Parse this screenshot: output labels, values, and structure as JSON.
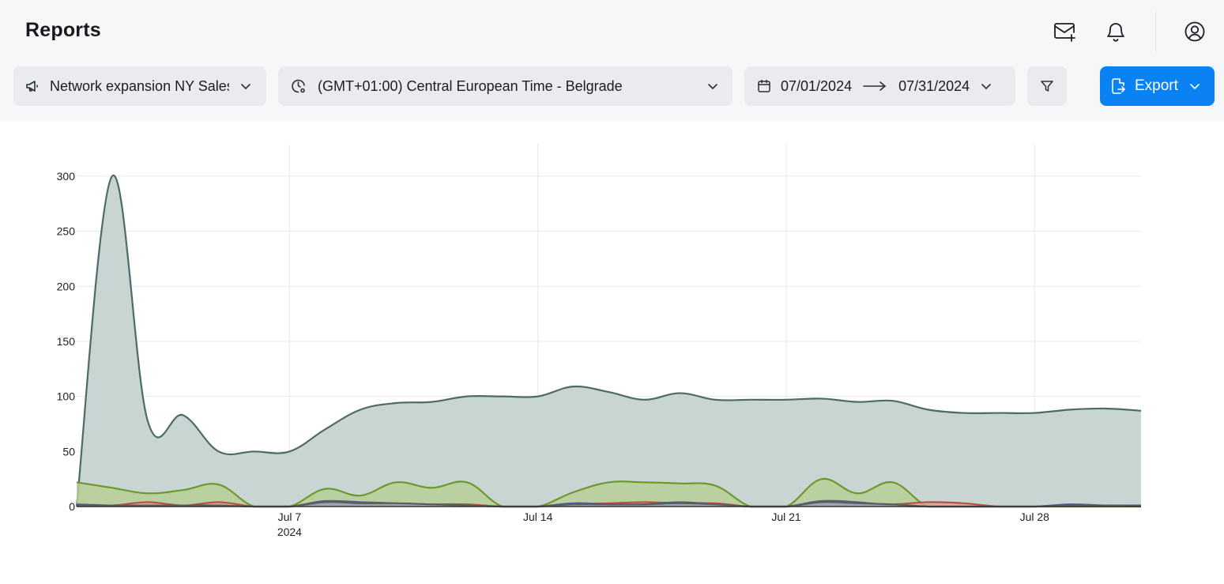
{
  "header": {
    "title": "Reports"
  },
  "icons": {
    "mail": "mail-plus-icon",
    "bell": "bell-icon",
    "user": "user-circle-icon"
  },
  "filters": {
    "campaign": {
      "label": "Network expansion NY Sales",
      "icon": "megaphone-icon"
    },
    "timezone": {
      "label": "(GMT+01:00) Central European Time - Belgrade",
      "icon": "clock-pin-icon"
    },
    "date_start": "07/01/2024",
    "date_end": "07/31/2024",
    "filter_icon": "funnel-icon"
  },
  "export": {
    "label": "Export",
    "color": "#0b82f4"
  },
  "chart_data": {
    "type": "area",
    "x": [
      "2024-07-01",
      "2024-07-02",
      "2024-07-03",
      "2024-07-04",
      "2024-07-05",
      "2024-07-06",
      "2024-07-07",
      "2024-07-08",
      "2024-07-09",
      "2024-07-10",
      "2024-07-11",
      "2024-07-12",
      "2024-07-13",
      "2024-07-14",
      "2024-07-15",
      "2024-07-16",
      "2024-07-17",
      "2024-07-18",
      "2024-07-19",
      "2024-07-20",
      "2024-07-21",
      "2024-07-22",
      "2024-07-23",
      "2024-07-24",
      "2024-07-25",
      "2024-07-26",
      "2024-07-27",
      "2024-07-28",
      "2024-07-29",
      "2024-07-30",
      "2024-07-31"
    ],
    "xticks": [
      {
        "date": "2024-07-07",
        "label": "Jul 7",
        "sublabel": "2024"
      },
      {
        "date": "2024-07-14",
        "label": "Jul 14",
        "sublabel": ""
      },
      {
        "date": "2024-07-21",
        "label": "Jul 21",
        "sublabel": ""
      },
      {
        "date": "2024-07-28",
        "label": "Jul 28",
        "sublabel": ""
      }
    ],
    "ylim": [
      0,
      315
    ],
    "yticks": [
      "0",
      "50",
      "100",
      "150",
      "200",
      "250",
      "300"
    ],
    "grid": true,
    "series": [
      {
        "color": "#4d6b66",
        "fill": "#c9d5d3",
        "values": [
          0,
          300,
          78,
          83,
          50,
          50,
          50,
          70,
          88,
          94,
          95,
          100,
          100,
          100,
          109,
          104,
          97,
          103,
          97,
          97,
          97,
          98,
          95,
          96,
          88,
          85,
          85,
          85,
          88,
          89,
          87
        ]
      },
      {
        "color": "#6b9a2a",
        "fill": "#b9cf98",
        "values": [
          22,
          17,
          12,
          15,
          20,
          0,
          0,
          16,
          10,
          22,
          17,
          22,
          0,
          0,
          13,
          22,
          22,
          21,
          19,
          0,
          0,
          25,
          12,
          22,
          0,
          0,
          0,
          0,
          0,
          0,
          0
        ]
      },
      {
        "color": "#b5533c",
        "fill": "#d9a596",
        "values": [
          1,
          1,
          4,
          1,
          4,
          0,
          0,
          3,
          3,
          2,
          2,
          2,
          0,
          0,
          2,
          3,
          4,
          3,
          3,
          0,
          0,
          4,
          3,
          2,
          4,
          3,
          0,
          0,
          1,
          1,
          1
        ]
      },
      {
        "color": "#4f5b8a",
        "fill": "#a8b0cc",
        "values": [
          2,
          1,
          1,
          1,
          1,
          0,
          0,
          5,
          4,
          3,
          2,
          1,
          0,
          0,
          3,
          2,
          2,
          4,
          2,
          0,
          0,
          5,
          4,
          1,
          0,
          0,
          0,
          0,
          2,
          1,
          1
        ]
      },
      {
        "color": "#5b5e63",
        "fill": "#9fa3a8",
        "values": [
          1,
          1,
          1,
          1,
          1,
          0,
          0,
          4,
          3,
          3,
          2,
          1,
          0,
          0,
          2,
          2,
          2,
          3,
          2,
          0,
          0,
          4,
          3,
          2,
          0,
          0,
          0,
          0,
          1,
          1,
          0
        ]
      }
    ]
  }
}
